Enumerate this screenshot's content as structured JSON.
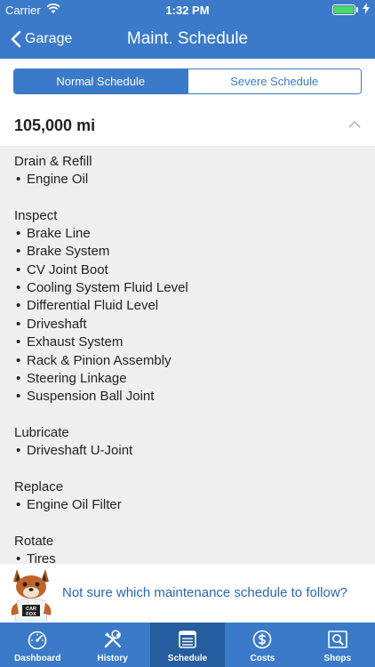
{
  "status_bar": {
    "carrier": "Carrier",
    "time": "1:32 PM",
    "wifi_icon": "wifi-icon",
    "battery_icon": "battery-icon",
    "charging_icon": "bolt-icon"
  },
  "nav": {
    "back_label": "Garage",
    "title": "Maint. Schedule"
  },
  "segment": {
    "options": [
      "Normal Schedule",
      "Severe Schedule"
    ],
    "selected": "Normal Schedule"
  },
  "mileage": {
    "label": "105,000 mi",
    "expanded": true
  },
  "schedule": {
    "bullet": "•",
    "groups": [
      {
        "title": "Drain & Refill",
        "items": [
          "Engine Oil"
        ]
      },
      {
        "title": "Inspect",
        "items": [
          "Brake Line",
          "Brake System",
          "CV Joint Boot",
          "Cooling System Fluid Level",
          "Differential Fluid Level",
          "Driveshaft",
          "Exhaust System",
          "Rack & Pinion Assembly",
          "Steering Linkage",
          "Suspension Ball Joint"
        ]
      },
      {
        "title": "Lubricate",
        "items": [
          "Driveshaft U-Joint"
        ]
      },
      {
        "title": "Replace",
        "items": [
          "Engine Oil Filter"
        ]
      },
      {
        "title": "Rotate",
        "items": [
          "Tires"
        ]
      }
    ]
  },
  "promo": {
    "text": "Not sure which maintenance schedule to follow?",
    "mascot_text": [
      "CAR",
      "FOX"
    ]
  },
  "tabbar": {
    "tabs": [
      {
        "label": "Dashboard",
        "icon": "speedometer-icon"
      },
      {
        "label": "History",
        "icon": "wrench-screwdriver-icon"
      },
      {
        "label": "Schedule",
        "icon": "schedule-list-icon"
      },
      {
        "label": "Costs",
        "icon": "dollar-icon"
      },
      {
        "label": "Shops",
        "icon": "shop-search-icon"
      }
    ],
    "active": "Schedule"
  },
  "colors": {
    "primary": "#3a7ac8",
    "active_tab": "#265d9e",
    "list_background": "#efefef",
    "link": "#2a66b0",
    "battery": "#4cd964"
  }
}
